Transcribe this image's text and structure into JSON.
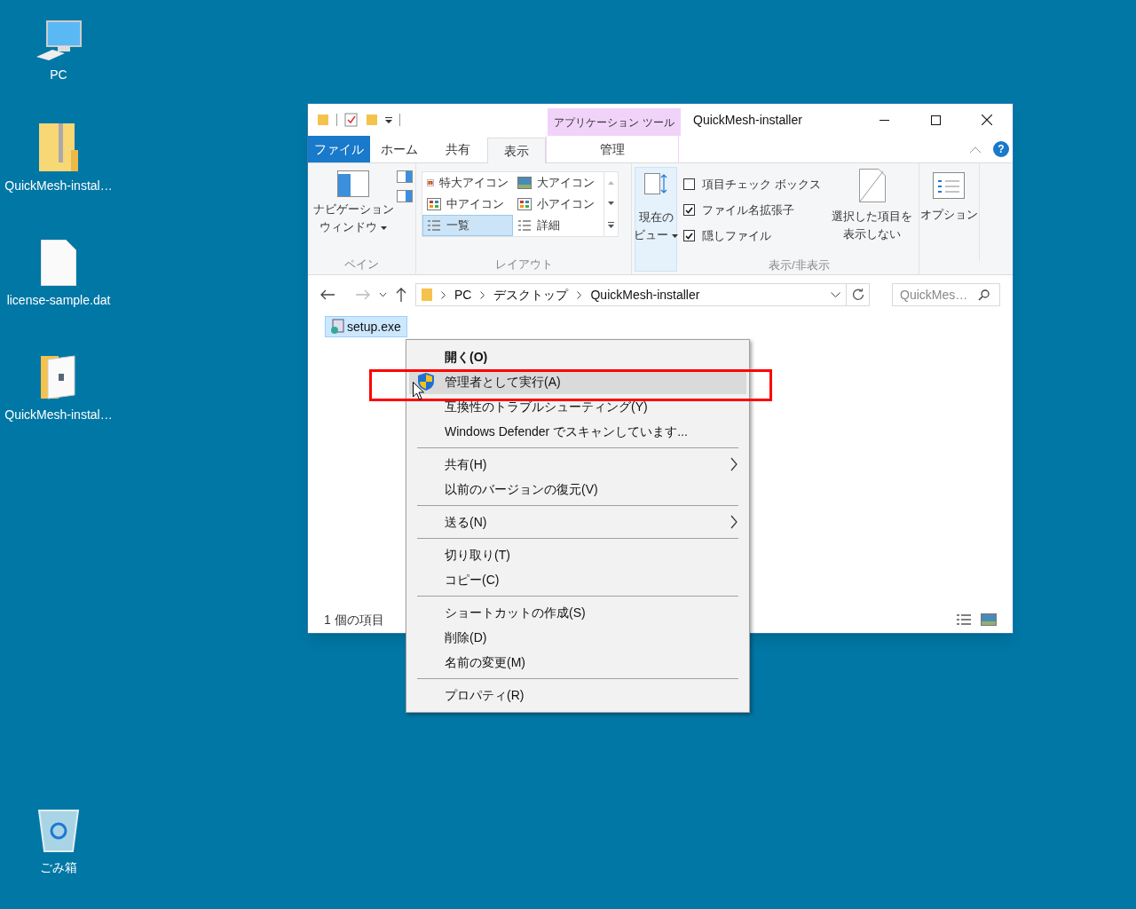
{
  "desktop_icons": [
    {
      "kind": "pc",
      "label": "PC"
    },
    {
      "kind": "zip",
      "label": "QuickMesh-instal…"
    },
    {
      "kind": "file",
      "label": "license-sample.dat"
    },
    {
      "kind": "folder",
      "label": "QuickMesh-instal…"
    },
    {
      "kind": "recycle",
      "label": "ごみ箱"
    }
  ],
  "window": {
    "title": "QuickMesh-installer",
    "contextual_group": "アプリケーション ツール",
    "tabs": [
      {
        "kind": "file",
        "label": "ファイル",
        "selected": false
      },
      {
        "kind": "normal",
        "label": "ホーム",
        "selected": false
      },
      {
        "kind": "normal",
        "label": "共有",
        "selected": false
      },
      {
        "kind": "normal",
        "label": "表示",
        "selected": true
      },
      {
        "kind": "contextual",
        "label": "管理",
        "selected": false
      }
    ],
    "ribbon": {
      "pane": {
        "button": [
          "ナビゲーション",
          "ウィンドウ"
        ],
        "label": "ペイン"
      },
      "layout": {
        "items": [
          {
            "kind": "xl",
            "label": "特大アイコン",
            "selected": false
          },
          {
            "kind": "large",
            "label": "大アイコン",
            "selected": false
          },
          {
            "kind": "medium",
            "label": "中アイコン",
            "selected": false
          },
          {
            "kind": "small",
            "label": "小アイコン",
            "selected": false
          },
          {
            "kind": "list",
            "label": "一覧",
            "selected": true
          },
          {
            "kind": "details",
            "label": "詳細",
            "selected": false
          }
        ],
        "label": "レイアウト"
      },
      "current_view": [
        "現在の",
        "ビュー"
      ],
      "show_hide": {
        "checkboxes": [
          {
            "label": "項目チェック ボックス",
            "checked": false
          },
          {
            "label": "ファイル名拡張子",
            "checked": true
          },
          {
            "label": "隠しファイル",
            "checked": true
          }
        ],
        "hide_button": [
          "選択した項目を",
          "表示しない"
        ],
        "label": "表示/非表示"
      },
      "options": "オプション"
    },
    "help": "?",
    "address": {
      "crumbs": [
        "PC",
        "デスクトップ",
        "QuickMesh-installer"
      ],
      "search_placeholder": "QuickMes…"
    },
    "files": [
      {
        "name": "setup.exe",
        "selected": true
      }
    ],
    "status": "1 個の項目"
  },
  "context_menu": [
    [
      {
        "kind": "plain",
        "label": "開く(O)",
        "default": true,
        "selected": false,
        "submenu": false
      },
      {
        "kind": "elevated",
        "label": "管理者として実行(A)",
        "default": false,
        "selected": true,
        "submenu": false
      },
      {
        "kind": "plain",
        "label": "互換性のトラブルシューティング(Y)",
        "default": false,
        "selected": false,
        "submenu": false
      },
      {
        "kind": "plain",
        "label": "Windows Defender でスキャンしています...",
        "default": false,
        "selected": false,
        "submenu": false
      }
    ],
    [
      {
        "kind": "plain",
        "label": "共有(H)",
        "default": false,
        "selected": false,
        "submenu": true
      },
      {
        "kind": "plain",
        "label": "以前のバージョンの復元(V)",
        "default": false,
        "selected": false,
        "submenu": false
      }
    ],
    [
      {
        "kind": "plain",
        "label": "送る(N)",
        "default": false,
        "selected": false,
        "submenu": true
      }
    ],
    [
      {
        "kind": "plain",
        "label": "切り取り(T)",
        "default": false,
        "selected": false,
        "submenu": false
      },
      {
        "kind": "plain",
        "label": "コピー(C)",
        "default": false,
        "selected": false,
        "submenu": false
      }
    ],
    [
      {
        "kind": "plain",
        "label": "ショートカットの作成(S)",
        "default": false,
        "selected": false,
        "submenu": false
      },
      {
        "kind": "plain",
        "label": "削除(D)",
        "default": false,
        "selected": false,
        "submenu": false
      },
      {
        "kind": "plain",
        "label": "名前の変更(M)",
        "default": false,
        "selected": false,
        "submenu": false
      }
    ],
    [
      {
        "kind": "plain",
        "label": "プロパティ(R)",
        "default": false,
        "selected": false,
        "submenu": false
      }
    ]
  ]
}
